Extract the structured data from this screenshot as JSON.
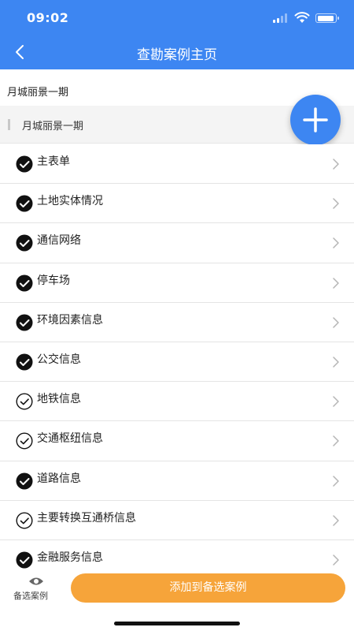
{
  "status_bar": {
    "time": "09:02"
  },
  "nav": {
    "title": "查勘案例主页",
    "back_icon": "chevron-left-icon"
  },
  "project": {
    "name": "月城丽景一期"
  },
  "section": {
    "title": "月城丽景一期"
  },
  "fab": {
    "icon": "plus-icon"
  },
  "items": [
    {
      "label": "主表单",
      "status": "filled"
    },
    {
      "label": "土地实体情况",
      "status": "filled"
    },
    {
      "label": "通信网络",
      "status": "filled"
    },
    {
      "label": "停车场",
      "status": "filled"
    },
    {
      "label": "环境因素信息",
      "status": "filled"
    },
    {
      "label": "公交信息",
      "status": "filled"
    },
    {
      "label": "地铁信息",
      "status": "outline"
    },
    {
      "label": "交通枢纽信息",
      "status": "outline"
    },
    {
      "label": "道路信息",
      "status": "filled"
    },
    {
      "label": "主要转换互通桥信息",
      "status": "outline"
    },
    {
      "label": "金融服务信息",
      "status": "filled"
    }
  ],
  "bottom": {
    "candidate_label": "备选案例",
    "add_button_label": "添加到备选案例"
  },
  "colors": {
    "primary": "#3d86f2",
    "accent": "#f6a43a"
  }
}
